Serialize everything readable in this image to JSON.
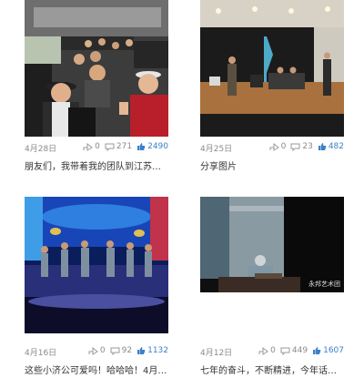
{
  "posts": [
    {
      "date": "4月28日",
      "shares": "0",
      "comments": "271",
      "likes": "2490",
      "caption": "朋友们，我带着我的团队到江苏巡…"
    },
    {
      "date": "4月25日",
      "shares": "0",
      "comments": "23",
      "likes": "482",
      "caption": "分享图片"
    },
    {
      "date": "4月16日",
      "shares": "0",
      "comments": "92",
      "likes": "1132",
      "caption": "这些小济公可爱吗！哈哈哈！4月1…"
    },
    {
      "date": "4月12日",
      "shares": "0",
      "comments": "449",
      "likes": "1607",
      "caption": "七年的奋斗，不断精进，今年话剧…",
      "watermark": "永邦艺术团"
    }
  ],
  "icons": {
    "share": "share-icon",
    "comment": "comment-icon",
    "like": "thumbs-up-icon"
  },
  "colors": {
    "like": "#3d7fc9",
    "meta": "#8a8a8a",
    "caption": "#333333"
  }
}
